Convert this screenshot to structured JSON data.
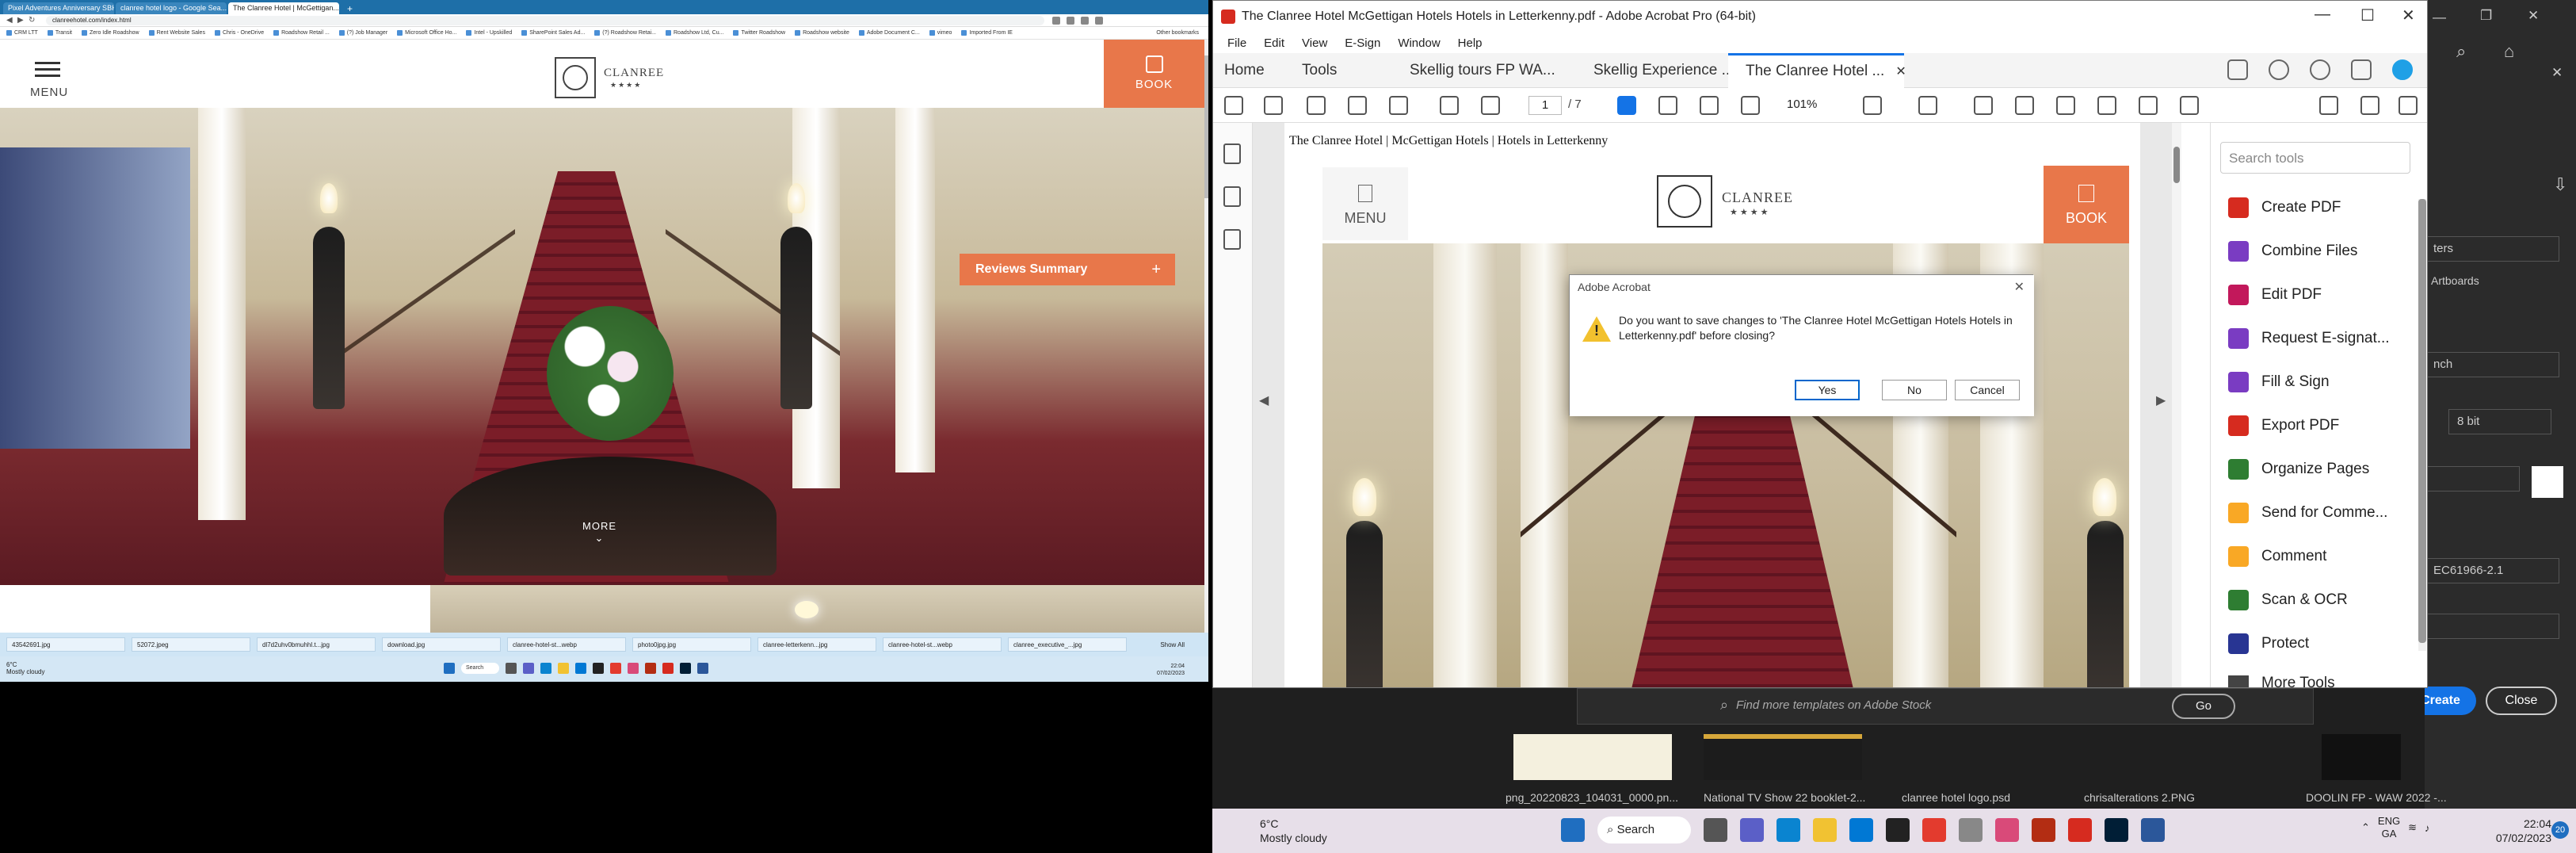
{
  "chrome": {
    "tabs": [
      {
        "label": "Pixel Adventures Anniversary SBH..."
      },
      {
        "label": "clanree hotel logo - Google Sea..."
      },
      {
        "label": "The Clanree Hotel | McGettigan..."
      }
    ],
    "new_tab": "+",
    "url": "clanreehotel.com/index.html",
    "bookmarks": [
      "CRM LTT",
      "Transit",
      "Zero Idle Roadshow",
      "Rent Website Sales",
      "Chris - OneDrive",
      "Roadshow Retail ...",
      "(?) Job Manager",
      "Microsoft Office Ho...",
      "Intel - Upskilled",
      "SharePoint Sales Ad...",
      "(?) Roadshow Retai...",
      "Roadshow Ltd, Cu...",
      "Twitter Roadshow",
      "Roadshow website",
      "Adobe Document C...",
      "vimeo",
      "Imported From IE"
    ],
    "other_bookmarks": "Other bookmarks"
  },
  "site": {
    "menu_label": "MENU",
    "logo_text": "CLANREE",
    "logo_stars": "★★★★",
    "book_label": "BOOK",
    "reviews_label": "Reviews Summary",
    "reviews_plus": "+",
    "more_label": "MORE"
  },
  "downloads": {
    "items": [
      "43542691.jpg",
      "52072.jpeg",
      "dl7d2uhv0bmuhhl.t...jpg",
      "download.jpg",
      "clanree-hotel-st...webp",
      "photo0jpg.jpg",
      "clanree-letterkenn...jpg",
      "clanree-hotel-st...webp",
      "clanree_executive_...jpg",
      "clanree_executive_...jpg"
    ],
    "show_all": "Show All"
  },
  "taskbar_left": {
    "temp": "6°C",
    "weather": "Mostly cloudy",
    "search": "Search",
    "time": "22:04",
    "date": "07/02/2023"
  },
  "acrobat": {
    "title": "The Clanree Hotel  McGettigan Hotels  Hotels in Letterkenny.pdf - Adobe Acrobat Pro (64-bit)",
    "menu": [
      "File",
      "Edit",
      "View",
      "E-Sign",
      "Window",
      "Help"
    ],
    "tabs": {
      "home": "Home",
      "tools": "Tools",
      "doc1": "Skellig tours FP WA...",
      "doc2": "Skellig Experience ...",
      "doc3": "The Clanree Hotel  ...",
      "close": "✕"
    },
    "page_current": "1",
    "page_total": "/ 7",
    "zoom": "101%",
    "search_placeholder": "Search tools",
    "tools": [
      {
        "label": "Create PDF",
        "color": "#d62b1f"
      },
      {
        "label": "Combine Files",
        "color": "#7a3cc2"
      },
      {
        "label": "Edit PDF",
        "color": "#c2185b"
      },
      {
        "label": "Request E-signat...",
        "color": "#7a3cc2"
      },
      {
        "label": "Fill & Sign",
        "color": "#7a3cc2"
      },
      {
        "label": "Export PDF",
        "color": "#d62b1f"
      },
      {
        "label": "Organize Pages",
        "color": "#2e7d32"
      },
      {
        "label": "Send for Comme...",
        "color": "#f9a825"
      },
      {
        "label": "Comment",
        "color": "#f9a825"
      },
      {
        "label": "Scan & OCR",
        "color": "#2e7d32"
      },
      {
        "label": "Protect",
        "color": "#283593"
      },
      {
        "label": "More Tools",
        "color": "#444444"
      }
    ]
  },
  "pdf": {
    "header": "The Clanree Hotel | McGettigan Hotels | Hotels in Letterkenny",
    "menu_label": "MENU",
    "logo_text": "CLANREE",
    "logo_stars": "★★★★",
    "book_label": "BOOK"
  },
  "dialog": {
    "title": "Adobe Acrobat",
    "message": "Do you want to save changes to 'The Clanree Hotel  McGettigan Hotels  Hotels in Letterkenny.pdf' before closing?",
    "yes": "Yes",
    "no": "No",
    "cancel": "Cancel"
  },
  "background_app": {
    "field1": "ters",
    "field2": "Artboards",
    "field3": "nch",
    "field4": "8 bit",
    "field5": "EC61966-2.1",
    "create": "Create",
    "close": "Close",
    "stock_placeholder": "Find more templates on Adobe Stock",
    "go": "Go",
    "thumb_labels": [
      "png_20220823_104031_0000.pn...",
      "National TV Show 22 booklet-2...",
      "clanree hotel logo.psd",
      "chrisalterations 2.PNG",
      "DOOLIN FP - WAW 2022 -..."
    ]
  },
  "taskbar_right": {
    "temp": "6°C",
    "weather": "Mostly cloudy",
    "search": "Search",
    "lang1": "ENG",
    "lang2": "GA",
    "time": "22:04",
    "date": "07/02/2023",
    "notifications": "20"
  }
}
